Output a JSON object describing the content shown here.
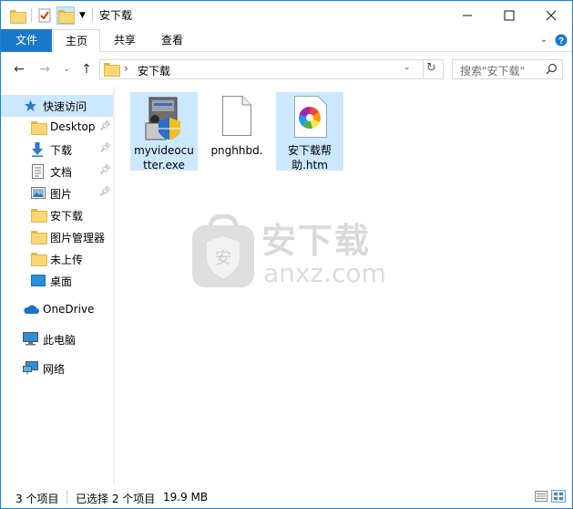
{
  "window": {
    "title": "安下载"
  },
  "window_controls": {
    "minimize": "—",
    "maximize": "☐",
    "close": "✕"
  },
  "ribbon": {
    "tabs": [
      "文件",
      "主页",
      "共享",
      "查看"
    ],
    "active_tab": "主页",
    "accent_color": "#1979ca"
  },
  "address": {
    "path": "安下载",
    "separator": "›",
    "search_placeholder": "搜索\"安下载\""
  },
  "sidebar": {
    "quick_access": "快速访问",
    "items": [
      {
        "label": "Desktop",
        "icon": "folder-icon",
        "pinned": true
      },
      {
        "label": "下载",
        "icon": "download-arrow-icon",
        "pinned": true
      },
      {
        "label": "文档",
        "icon": "document-icon",
        "pinned": true
      },
      {
        "label": "图片",
        "icon": "picture-icon",
        "pinned": true
      },
      {
        "label": "安下载",
        "icon": "folder-icon",
        "pinned": false
      },
      {
        "label": "图片管理器",
        "icon": "folder-icon",
        "pinned": false
      },
      {
        "label": "未上传",
        "icon": "folder-icon",
        "pinned": false
      },
      {
        "label": "桌面",
        "icon": "desktop-icon",
        "pinned": false
      }
    ],
    "onedrive": "OneDrive",
    "this_pc": "此电脑",
    "network": "网络"
  },
  "files": [
    {
      "name_line1": "myvideocu",
      "name_line2": "tter.exe",
      "icon": "installer-exe-icon",
      "selected": true
    },
    {
      "name_line1": "pnghhbd.",
      "name_line2": "",
      "icon": "blank-file-icon",
      "selected": false
    },
    {
      "name_line1": "安下载帮",
      "name_line2": "助.htm",
      "icon": "browser-html-icon",
      "selected": true
    }
  ],
  "watermark": {
    "text_cn": "安下载",
    "text_en": "anxz.com"
  },
  "status": {
    "item_count": "3 个项目",
    "selected": "已选择 2 个项目",
    "size": "19.9 MB"
  }
}
